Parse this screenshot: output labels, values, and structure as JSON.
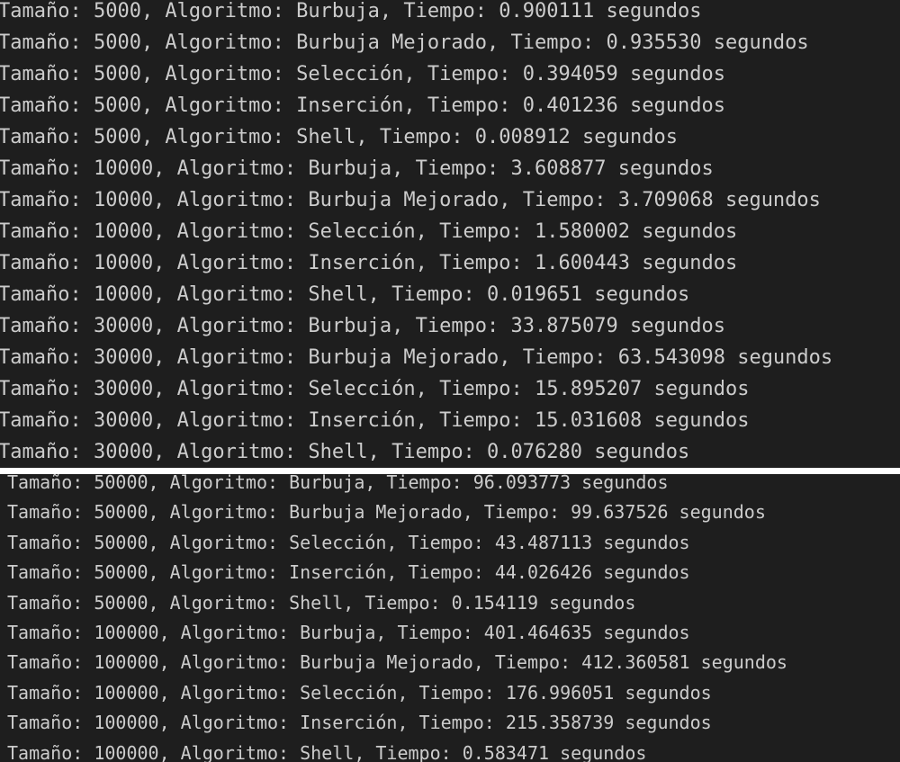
{
  "terminal_top": {
    "lines": [
      "Tamaño: 5000, Algoritmo: Burbuja, Tiempo: 0.900111 segundos",
      "Tamaño: 5000, Algoritmo: Burbuja Mejorado, Tiempo: 0.935530 segundos",
      "Tamaño: 5000, Algoritmo: Selección, Tiempo: 0.394059 segundos",
      "Tamaño: 5000, Algoritmo: Inserción, Tiempo: 0.401236 segundos",
      "Tamaño: 5000, Algoritmo: Shell, Tiempo: 0.008912 segundos",
      "Tamaño: 10000, Algoritmo: Burbuja, Tiempo: 3.608877 segundos",
      "Tamaño: 10000, Algoritmo: Burbuja Mejorado, Tiempo: 3.709068 segundos",
      "Tamaño: 10000, Algoritmo: Selección, Tiempo: 1.580002 segundos",
      "Tamaño: 10000, Algoritmo: Inserción, Tiempo: 1.600443 segundos",
      "Tamaño: 10000, Algoritmo: Shell, Tiempo: 0.019651 segundos",
      "Tamaño: 30000, Algoritmo: Burbuja, Tiempo: 33.875079 segundos",
      "Tamaño: 30000, Algoritmo: Burbuja Mejorado, Tiempo: 63.543098 segundos",
      "Tamaño: 30000, Algoritmo: Selección, Tiempo: 15.895207 segundos",
      "Tamaño: 30000, Algoritmo: Inserción, Tiempo: 15.031608 segundos",
      "Tamaño: 30000, Algoritmo: Shell, Tiempo: 0.076280 segundos"
    ]
  },
  "terminal_bottom": {
    "lines": [
      "Tamaño: 50000, Algoritmo: Burbuja, Tiempo: 96.093773 segundos",
      "Tamaño: 50000, Algoritmo: Burbuja Mejorado, Tiempo: 99.637526 segundos",
      "Tamaño: 50000, Algoritmo: Selección, Tiempo: 43.487113 segundos",
      "Tamaño: 50000, Algoritmo: Inserción, Tiempo: 44.026426 segundos",
      "Tamaño: 50000, Algoritmo: Shell, Tiempo: 0.154119 segundos",
      "Tamaño: 100000, Algoritmo: Burbuja, Tiempo: 401.464635 segundos",
      "Tamaño: 100000, Algoritmo: Burbuja Mejorado, Tiempo: 412.360581 segundos",
      "Tamaño: 100000, Algoritmo: Selección, Tiempo: 176.996051 segundos",
      "Tamaño: 100000, Algoritmo: Inserción, Tiempo: 215.358739 segundos",
      "Tamaño: 100000, Algoritmo: Shell, Tiempo: 0.583471 segundos"
    ]
  },
  "colors": {
    "background": "#1e1e1e",
    "text": "#cccccc",
    "divider": "#ffffff"
  }
}
